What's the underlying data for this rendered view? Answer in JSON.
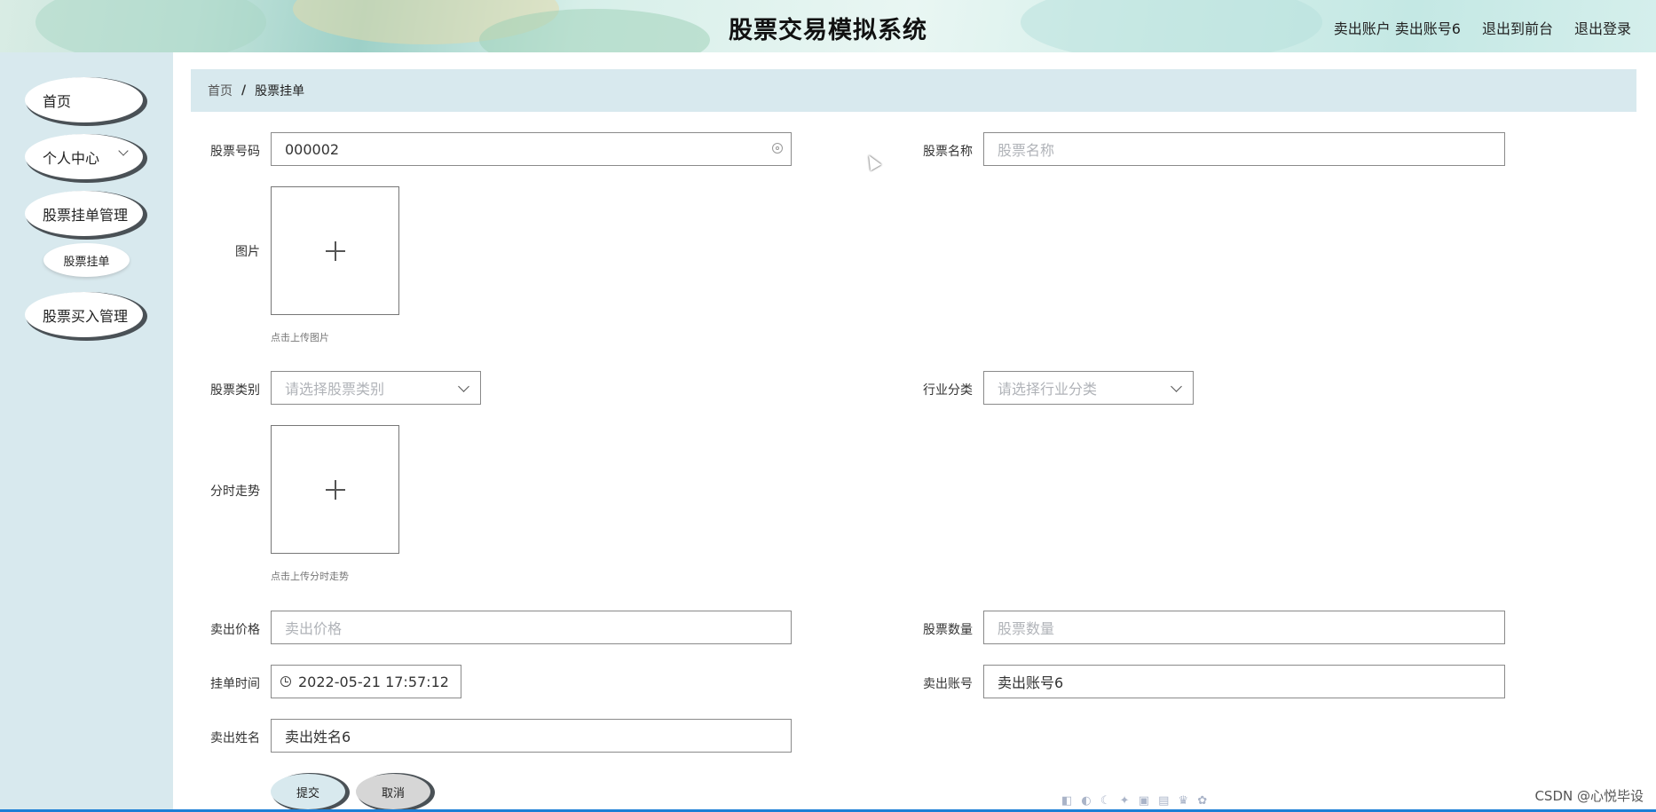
{
  "header": {
    "title": "股票交易模拟系统",
    "account_text": "卖出账户 卖出账号6",
    "to_frontend": "退出到前台",
    "logout": "退出登录"
  },
  "sidebar": {
    "items": [
      {
        "label": "首页"
      },
      {
        "label": "个人中心"
      },
      {
        "label": "股票挂单管理"
      },
      {
        "label": "股票挂单"
      },
      {
        "label": "股票买入管理"
      }
    ]
  },
  "breadcrumb": {
    "home": "首页",
    "separator": "/",
    "current": "股票挂单"
  },
  "form": {
    "stock_code": {
      "label": "股票号码",
      "value": "000002"
    },
    "stock_name": {
      "label": "股票名称",
      "placeholder": "股票名称"
    },
    "image": {
      "label": "图片",
      "hint": "点击上传图片"
    },
    "stock_category": {
      "label": "股票类别",
      "placeholder": "请选择股票类别"
    },
    "industry": {
      "label": "行业分类",
      "placeholder": "请选择行业分类"
    },
    "trend": {
      "label": "分时走势",
      "hint": "点击上传分时走势"
    },
    "sell_price": {
      "label": "卖出价格",
      "placeholder": "卖出价格"
    },
    "quantity": {
      "label": "股票数量",
      "placeholder": "股票数量"
    },
    "order_time": {
      "label": "挂单时间",
      "value": "2022-05-21 17:57:12"
    },
    "sell_account": {
      "label": "卖出账号",
      "value": "卖出账号6"
    },
    "seller_name": {
      "label": "卖出姓名",
      "value": "卖出姓名6"
    },
    "submit": "提交",
    "cancel": "取消"
  },
  "watermark": "CSDN @心悦毕设"
}
